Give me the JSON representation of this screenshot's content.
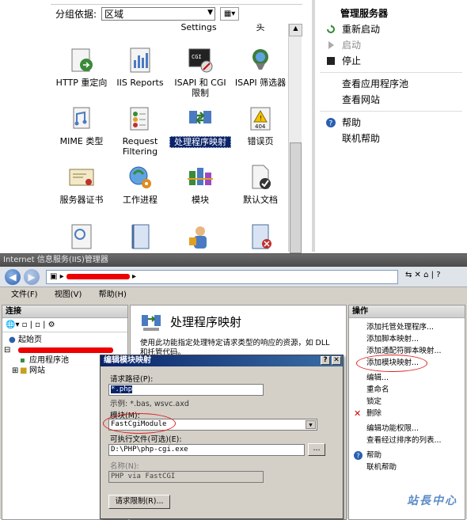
{
  "top": {
    "group_label": "分组依据:",
    "group_value": "区域",
    "partial_labels": [
      "Settings",
      "头"
    ],
    "features": [
      {
        "label": "HTTP 重定向",
        "icon": "http-redirect-icon"
      },
      {
        "label": "IIS Reports",
        "icon": "iis-reports-icon"
      },
      {
        "label": "ISAPI 和 CGI 限制",
        "icon": "isapi-cgi-icon"
      },
      {
        "label": "ISAPI 筛选器",
        "icon": "isapi-filter-icon"
      },
      {
        "label": "MIME 类型",
        "icon": "mime-icon"
      },
      {
        "label": "Request Filtering",
        "icon": "request-filtering-icon"
      },
      {
        "label": "处理程序映射",
        "icon": "handler-mappings-icon",
        "selected": true
      },
      {
        "label": "错误页",
        "icon": "error-pages-icon"
      },
      {
        "label": "服务器证书",
        "icon": "certificate-icon"
      },
      {
        "label": "工作进程",
        "icon": "worker-process-icon"
      },
      {
        "label": "模块",
        "icon": "modules-icon"
      },
      {
        "label": "默认文档",
        "icon": "default-document-icon"
      }
    ],
    "sidebar": {
      "title": "管理服务器",
      "items": [
        {
          "label": "重新启动",
          "disabled": false
        },
        {
          "label": "启动",
          "disabled": true
        },
        {
          "label": "停止",
          "disabled": false
        },
        {
          "label": "查看应用程序池",
          "disabled": false
        },
        {
          "label": "查看网站",
          "disabled": false
        },
        {
          "label": "帮助",
          "disabled": false
        },
        {
          "label": "联机帮助",
          "disabled": false
        }
      ]
    }
  },
  "window": {
    "title": "Internet 信息服务(IIS)管理器",
    "menu": [
      "文件(F)",
      "视图(V)",
      "帮助(H)"
    ],
    "connections": {
      "title": "连接",
      "tree": [
        "起始页",
        "应用程序池",
        "网站"
      ]
    },
    "content": {
      "title": "处理程序映射",
      "desc": "使用此功能指定处理特定请求类型的响应的资源，如 DLL 和托管代码。"
    },
    "actions": {
      "title": "操作",
      "items": [
        "添加托管处理程序...",
        "添加脚本映射...",
        "添加通配符脚本映射...",
        "添加模块映射...",
        "编辑...",
        "重命名",
        "锁定",
        "删除",
        "编辑功能权限...",
        "查看经过排序的列表...",
        "帮助",
        "联机帮助"
      ]
    }
  },
  "dialog": {
    "title": "编辑模块映射",
    "request_path_label": "请求路径(P):",
    "request_path_value": "*.php",
    "example_text": "示例: *.bas, wsvc.axd",
    "module_label": "模块(M):",
    "module_value": "FastCgiModule",
    "exe_label": "可执行文件(可选)(E):",
    "exe_value": "D:\\PHP\\php-cgi.exe",
    "browse_label": "...",
    "name_label": "名称(N):",
    "name_value": "PHP via FastCGI",
    "restrictions_button": "请求限制(R)..."
  },
  "watermark": "站長中心",
  "colors": {
    "highlight": "#0a246a",
    "annotation": "#dd2222"
  }
}
